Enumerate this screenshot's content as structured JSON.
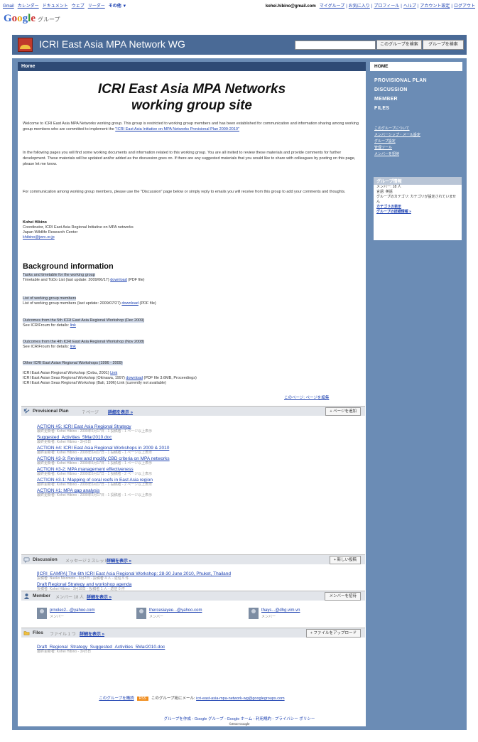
{
  "topnav": {
    "left_links": [
      "Gmail",
      "カレンダー",
      "ドキュメント",
      "ウェブ",
      "リーダー",
      "その他 ▼"
    ],
    "email": "kohei.hibino@gmail.com",
    "right_links": [
      "マイグループ",
      "お気に入り",
      "プロフィール",
      "ヘルプ",
      "アカウント設定",
      "ログアウト"
    ]
  },
  "logo": {
    "letters": [
      "G",
      "o",
      "o",
      "g",
      "l",
      "e"
    ],
    "sub": "グループ"
  },
  "banner": {
    "title": "ICRI East Asia MPA Network WG",
    "search_button": "このグループを検索",
    "groups_button": "グループを検索"
  },
  "home_bar": "Home",
  "heading": [
    "ICRI East Asia MPA Networks",
    "working group site"
  ],
  "intro": {
    "p1": "Welcome to ICRI East Asia MPA Networks working group. This group is restricted to working group members and has been established for communication and information sharing among working group members who are committed to implement the",
    "p1_link": "\"ICRI East Asia Initiative on MPA Networks Provisional Plan 2009-2010\"",
    "p2": "In the following pages you will find some working documents and information related to this working group. You are all invited to review these materials and provide comments for further development. These materials will be updated and/or added as the discussion goes on. If there are any suggested materials that you would like to share with colleagues by posting on this page, please let me know.",
    "p3": "For communication among working group members, please use the \"Discussion\" page below or simply reply to emails you will receive from this group to add your comments and thoughts."
  },
  "signature": {
    "name": "Kohei Hibino",
    "line1": "Coordinator, ICRI East Asia Regional Initiative on MPA networks",
    "line2": "Japan Wildlife Research Center",
    "email": "khibino@jwrc.or.jp"
  },
  "background": {
    "title": "Background information",
    "items": [
      {
        "head": "Tasks and timetable for the working group",
        "lines": [
          "Timetable and ToDo List (last update: 2009/06/17) ",
          "download",
          " (PDF file)"
        ]
      },
      {
        "head": "List of working group members",
        "lines": [
          "List of working group members (last update: 2009/07/27) ",
          "download",
          " (PDF file)"
        ]
      },
      {
        "head": "Outcomes from the 5th ICRI East Asia Regional Workshop (Dec 2009)",
        "lines": [
          "See ICRIFroum for details: ",
          "link",
          ""
        ]
      },
      {
        "head": "Outcomes from the 4th ICRI East Asia Regional Workshop (Nov 2008)",
        "lines": [
          "See ICRIFroum for details: ",
          "link",
          ""
        ]
      },
      {
        "head": "Other ICRI East Asian Regional Workshops (1996 - 2009)",
        "lines": []
      }
    ],
    "other_lines": [
      {
        "text": "ICRI East Asian Regional Workshop (Cebu, 2001) ",
        "link": "Link",
        "tail": ""
      },
      {
        "text": "ICRI East Asian Seas Regional Workshop (Okinawa, 1997) ",
        "link": "download",
        "tail": " (PDF file 3.6MB, Proceedings)"
      },
      {
        "text": "ICRI East Asian Seas Regional Workshop (Bali, 1996) Link (currently not available)",
        "link": "",
        "tail": ""
      }
    ],
    "edit_link": "このページ: ページを編集"
  },
  "sections": {
    "plan": {
      "name": "Provisional Plan",
      "count": "7 ページ",
      "more": "詳細を表示 »",
      "action": "+ ページを追加",
      "items": [
        {
          "title": "ACTION #5: ICRI East Asia Regional Strategy",
          "meta": "最終更新者: Kohei Hibino - 2009年6月17日 - 1 投稿者 - 1 ページ以上表示"
        },
        {
          "title": "Suggested_Activities_5Mar2010.doc",
          "meta": "最終更新者: Kohei Hibino - 3月5日"
        },
        {
          "title": "ACTION #4: ICRI East Asia Regional Workshops in 2009 & 2010",
          "meta": "最終更新者: Kohei Hibino - 2009年6月17日 - 1 投稿者 - 1 ページ以上表示"
        },
        {
          "title": "ACTION #3-3: Review and modify CBD criteria on MPA networks",
          "meta": "最終更新者: Kohei Hibino - 2009年6月17日 - 1 投稿者 - 1 ページ以上表示"
        },
        {
          "title": "ACTION #3-2: MPA management effectiveness",
          "meta": "最終更新者: Kohei Hibino - 2009年6月17日 - 1 投稿者 - 2 ページ以上表示"
        },
        {
          "title": "ACTION #3-1: Mapping of coral reefs in East Asia region",
          "meta": "最終更新者: Kohei Hibino - 2009年6月17日 - 1 投稿者 - 2 ページ以上表示"
        },
        {
          "title": "ACTION #1: MPA gap analysis",
          "meta": "最終更新者: Kohei Hibino - 2009年6月17日 - 1 投稿者 - 1 ページ以上表示"
        }
      ]
    },
    "discussion": {
      "name": "Discussion",
      "count": "メッセージ 2 スレッド",
      "more": "詳細を表示 »",
      "action": "+ 新しい投稿",
      "items": [
        {
          "title": "[ICRI_EAMPA] The 6th ICRI East Asia Regional Workshop: 28-30 June 2010, Phuket, Thailand",
          "meta": "投稿者: Naoko Morimoto - 6月2日 - 投稿者 4 人 - 返信 5 件"
        },
        {
          "title": "Draft Regional Strategy and workshop agenda",
          "meta": "投稿者: Kohei Hibino - 3月18日 - 投稿者 1 人 - 返信 0 件"
        }
      ]
    },
    "member": {
      "name": "Member",
      "count": "メンバー 18 人",
      "more": "詳細を表示 »",
      "action": "メンバーを招待",
      "items": [
        {
          "email": "prnolec2...@yahoo.com",
          "role": "メンバー"
        },
        {
          "email": "thercesiayee...@yahoo.com",
          "role": "メンバー"
        },
        {
          "email": "thays...@dhg.vim.vn",
          "role": "メンバー"
        }
      ]
    },
    "files": {
      "name": "Files",
      "count": "ファイル 1 つ",
      "more": "詳細を表示 »",
      "action": "+ ファイルをアップロード",
      "items": [
        {
          "title": "Draft_Regional_Strategy_Suggested_Activities_5Mar2010.doc",
          "meta": "最終更新者: Kohei Hibino - 3月5日"
        }
      ]
    }
  },
  "footer": {
    "subscribe": "このグループを購読",
    "rss": "RSS",
    "mail_label": "このグループ宛にメール: ",
    "mail": "icri-east-asia-mpa-network-wg@googlegroups.com",
    "links": "グループを作成 - Google グループ - Google ホーム - 利用規約 - プライバシー ポリシー",
    "copy": "©2010 Google"
  },
  "sidebar": {
    "home": "HOME",
    "nav": [
      "PROVISIONAL PLAN",
      "DISCUSSION",
      "MEMBER",
      "FILES"
    ],
    "links": [
      "このグループについて",
      "メンバーシップ・メール設定",
      "グループ設定",
      "管理ツール",
      "メンバーを招待"
    ],
    "info": {
      "title": "グループ情報",
      "lines": [
        "メンバー: 18 人",
        "言語: 英語",
        "グループのカテゴリ: カテゴリが設定されていません"
      ],
      "links": [
        "カテゴリの表示",
        "グループの詳細情報 »"
      ]
    }
  }
}
